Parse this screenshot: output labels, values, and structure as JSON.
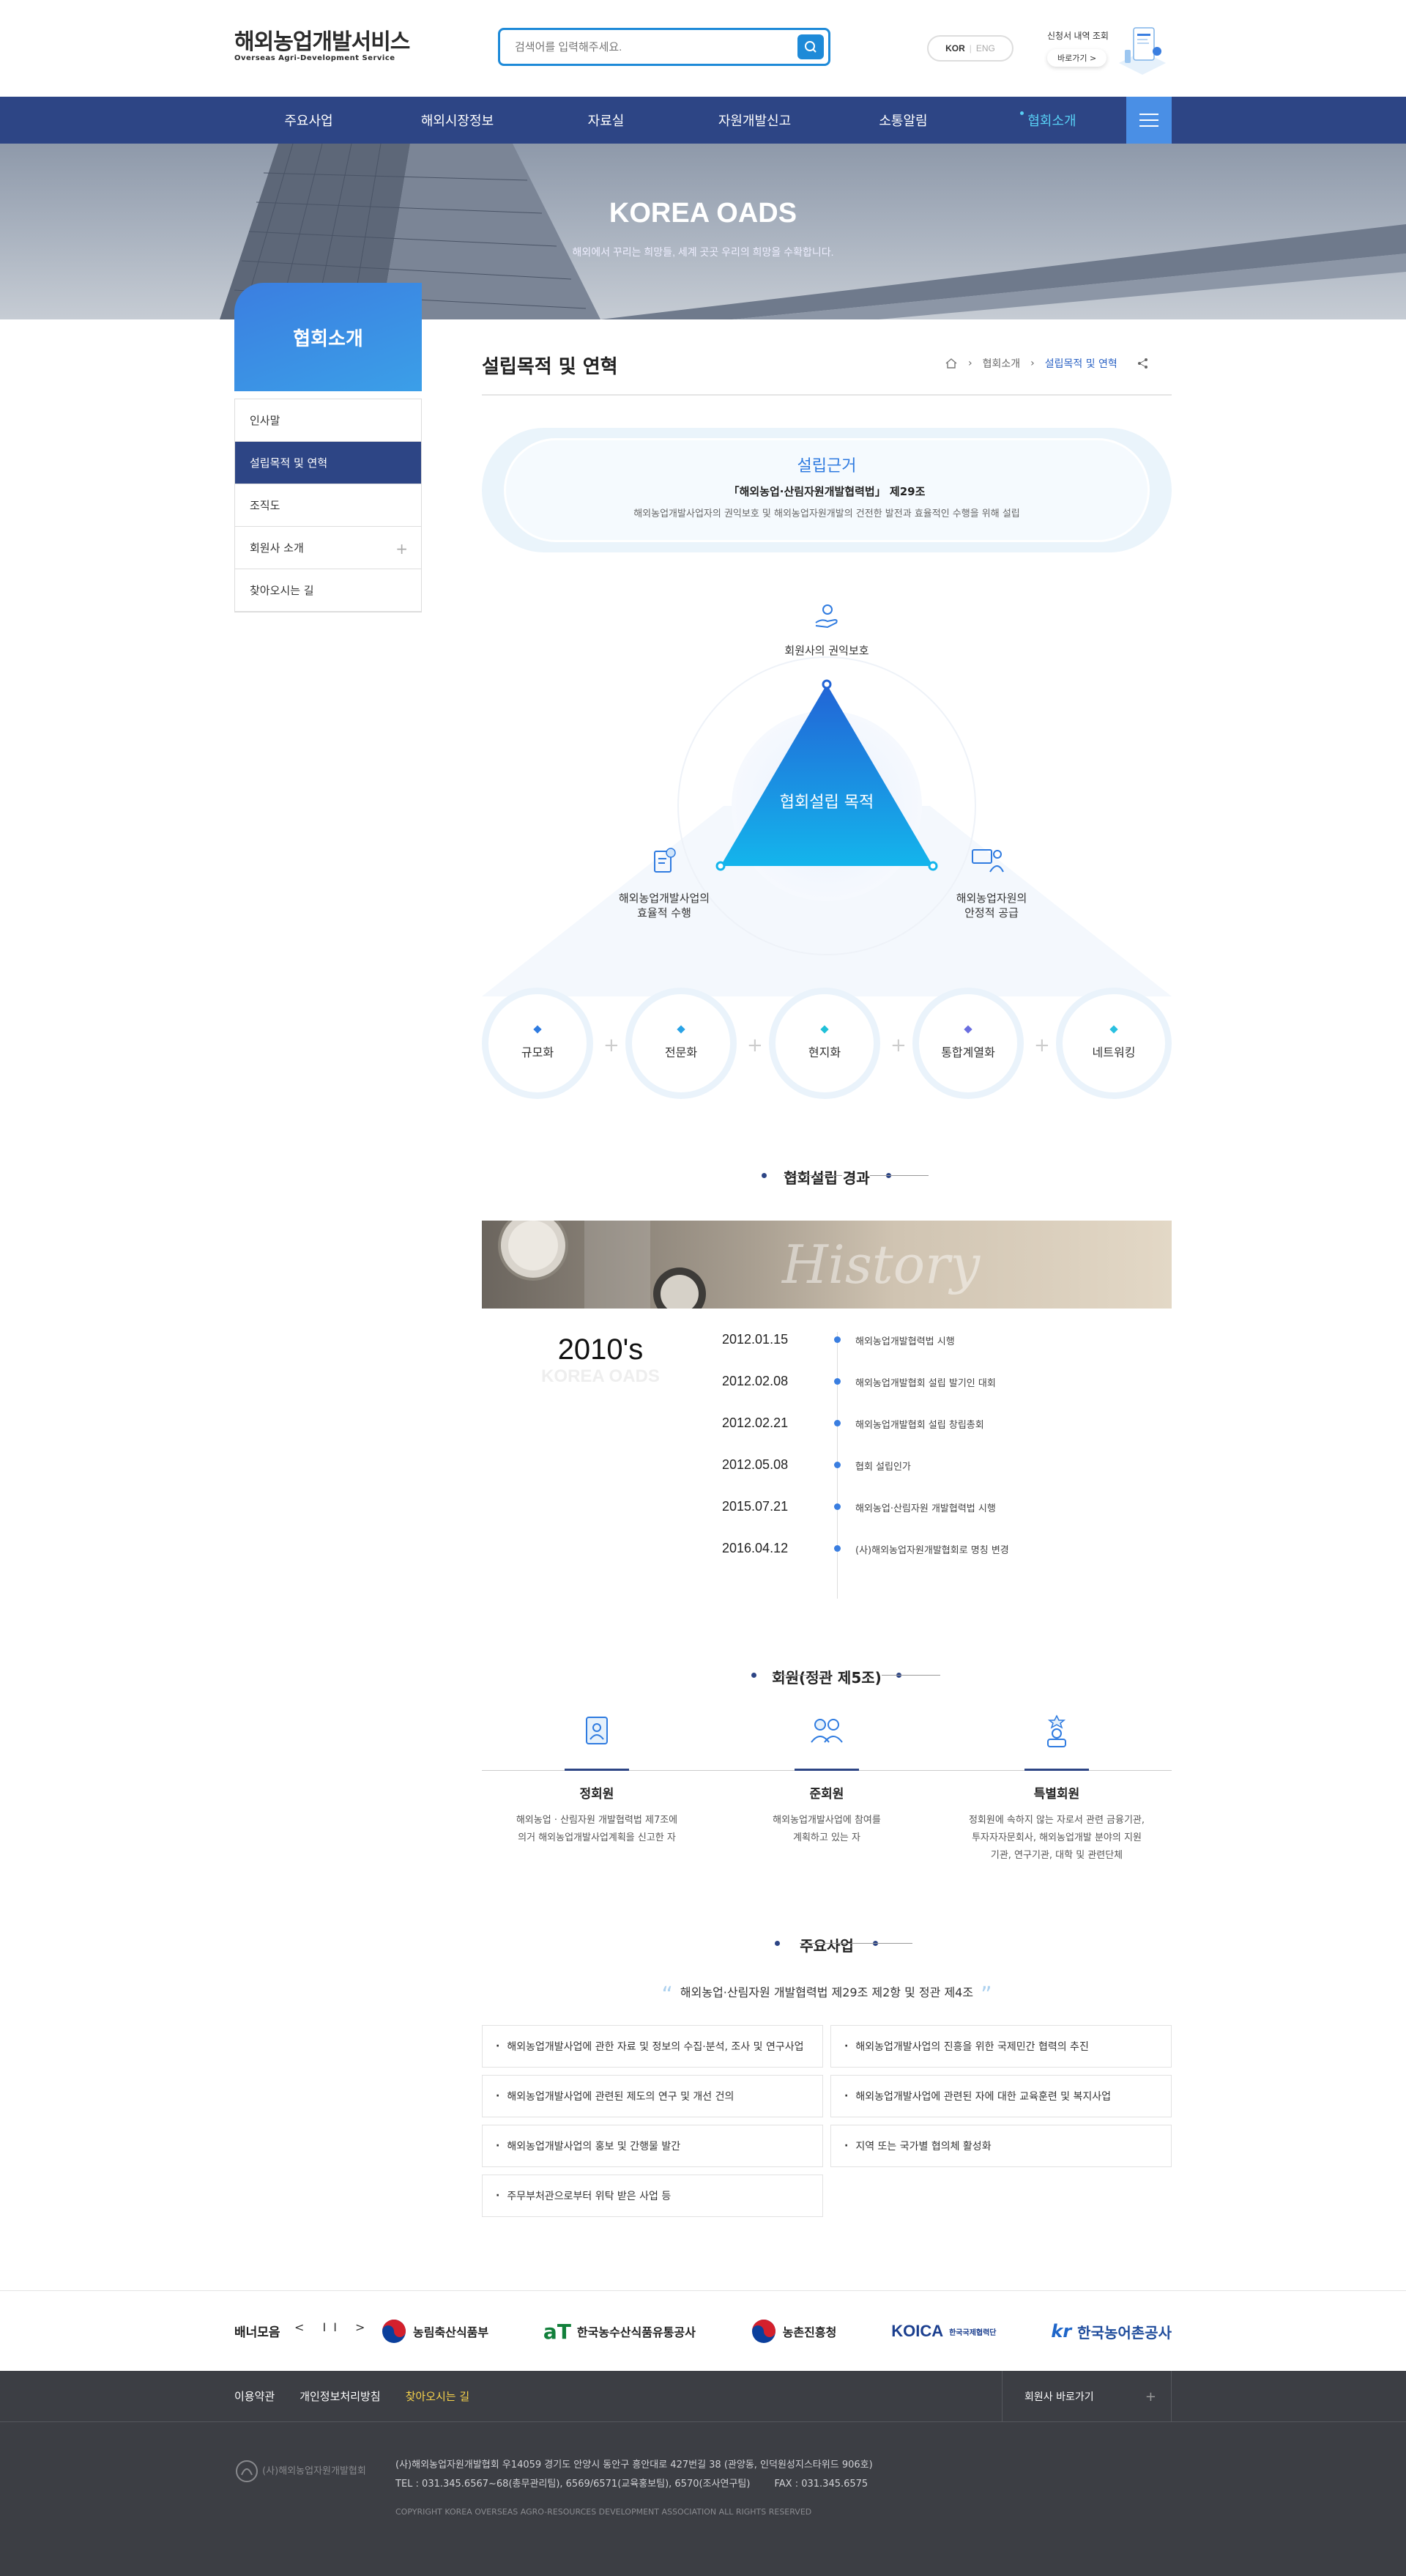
{
  "header": {
    "logo_ko": "해외농업개발서비스",
    "logo_en": "Overseas Agri-Development Service",
    "search_placeholder": "검색어를 입력해주세요.",
    "lang_on": "KOR",
    "lang_off": "ENG",
    "apply_title": "신청서 내역 조회",
    "apply_button": "바로가기 >"
  },
  "gnb": [
    "주요사업",
    "해외시장정보",
    "자료실",
    "자원개발신고",
    "소통알림",
    "협회소개"
  ],
  "visual": {
    "title": "KOREA OADS",
    "subtitle": "해외에서 꾸리는 희망들, 세계 곳곳 우리의 희망을 수확합니다."
  },
  "lnb": {
    "title": "협회소개",
    "items": [
      "인사말",
      "설립목적 및 연혁",
      "조직도",
      "회원사 소개",
      "찾아오시는 길"
    ]
  },
  "content": {
    "title": "설립목적 및 연혁",
    "breadcrumb": [
      "협회소개",
      "설립목적 및 연혁"
    ]
  },
  "basis": {
    "title": "설립근거",
    "law": "「해외농업·산림자원개발협력법」 제29조",
    "desc": "해외농업개발사업자의 권익보호 및 해외농업자원개발의 건전한 발전과 효율적인 수행을 위해 설립"
  },
  "purpose": {
    "center": "협회설립 목적",
    "top": "회원사의 권익보호",
    "left": "해외농업개발사업의\n효율적 수행",
    "right": "해외농업자원의\n안정적 공급",
    "circles": [
      "규모화",
      "전문화",
      "현지화",
      "통합계열화",
      "네트워킹"
    ]
  },
  "history": {
    "title": "협회설립 경과",
    "image_text": "History",
    "era": "2010's",
    "era_sub": "KOREA OADS",
    "events": [
      {
        "date": "2012.01.15",
        "text": "해외농업개발협력법 시행"
      },
      {
        "date": "2012.02.08",
        "text": "해외농업개발협회 설립 발기인 대회"
      },
      {
        "date": "2012.02.21",
        "text": "해외농업개발협회 설립 창립총회"
      },
      {
        "date": "2012.05.08",
        "text": "협회 설립인가"
      },
      {
        "date": "2015.07.21",
        "text": "해외농업·산림자원 개발협력법 시행"
      },
      {
        "date": "2016.04.12",
        "text": "(사)해외농업자원개발협회로 명칭 변경"
      }
    ]
  },
  "members": {
    "title": "회원(정관 제5조)",
    "types": [
      {
        "name": "정회원",
        "desc1": "해외농업 · 산림자원 개발협력법 제7조에",
        "desc2": "의거 해외농업개발사업계획을 신고한 자",
        "desc3": ""
      },
      {
        "name": "준회원",
        "desc1": "해외농업개발사업에 참여를",
        "desc2": "계획하고 있는 자",
        "desc3": ""
      },
      {
        "name": "특별회원",
        "desc1": "정회원에 속하지 않는 자로서 관련 금융기관,",
        "desc2": "투자자자문회사, 해외농업개발 분야의 지원",
        "desc3": "기관, 연구기관, 대학 및 관련단체"
      }
    ]
  },
  "business": {
    "title": "주요사업",
    "subtitle": "해외농업·산림자원 개발협력법 제29조 제2항 및 정관 제4조",
    "items": [
      "해외농업개발사업에 관한 자료 및 정보의 수집·분석, 조사 및 연구사업",
      "해외농업개발사업의 진흥을 위한 국제민간 협력의 추진",
      "해외농업개발사업에 관련된 제도의 연구 및 개선 건의",
      "해외농업개발사업에 관련된 자에 대한 교육훈련 및 복지사업",
      "해외농업개발사업의 홍보 및 간행물 발간",
      "지역 또는 국가별 협의체 활성화",
      "주무부처관으로부터 위탁 받은 사업 등"
    ]
  },
  "banner": {
    "title": "배너모음",
    "controls": "< II >",
    "logos": [
      "농림축산식품부",
      "한국농수산식품유통공사",
      "농촌진흥청",
      "KOICA",
      "한국농어촌공사"
    ],
    "koica_sub": "한국국제협력단"
  },
  "footer": {
    "links": [
      "이용약관",
      "개인정보처리방침",
      "찾아오시는 길"
    ],
    "family_site": "회원사 바로가기",
    "logo": "(사)해외농업자원개발협회",
    "address": "(사)해외농업자원개발협회 우14059 경기도 안양시 동안구 흥안대로 427번길 38 (관양동, 인덕원성지스타위드 906호)",
    "tel": "TEL : 031.345.6567~68(총무관리팀), 6569/6571(교육홍보팀), 6570(조사연구팀)        FAX : 031.345.6575",
    "copyright": "COPYRIGHT KOREA OVERSEAS AGRO-RESOURCES DEVELOPMENT ASSOCIATION ALL RIGHTS RESERVED"
  },
  "colors": {
    "navy": "#2d4585",
    "accent": "#1e8ad8",
    "footer": "#3c3e44"
  }
}
